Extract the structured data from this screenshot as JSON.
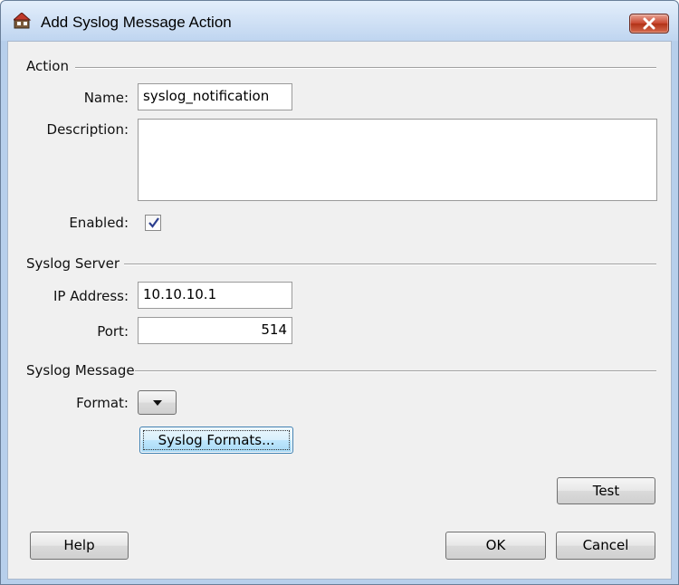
{
  "window": {
    "title": "Add Syslog Message Action",
    "app_icon": "syslog-app-icon",
    "close_icon": "close-icon"
  },
  "action": {
    "section_title": "Action",
    "name_label": "Name:",
    "name_value": "syslog_notification",
    "description_label": "Description:",
    "description_value": "",
    "enabled_label": "Enabled:",
    "enabled_checked": true
  },
  "server": {
    "section_title": "Syslog Server",
    "ip_label": "IP Address:",
    "ip_value": "10.10.10.1",
    "port_label": "Port:",
    "port_value": "514"
  },
  "message": {
    "section_title": "Syslog Message",
    "format_label": "Format:",
    "format_value": "",
    "formats_button": "Syslog Formats..."
  },
  "buttons": {
    "test": "Test",
    "help": "Help",
    "ok": "OK",
    "cancel": "Cancel"
  }
}
